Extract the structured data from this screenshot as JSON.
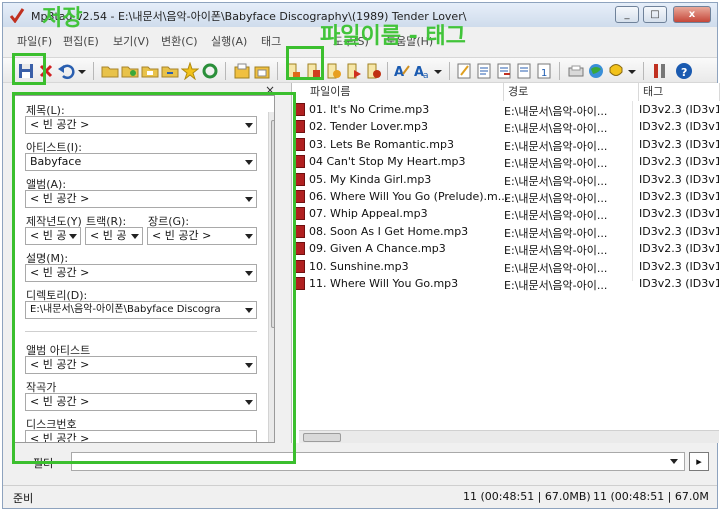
{
  "window": {
    "title": "Mp3tag v2.54 - E:\\내문서\\음악-아이폰\\Babyface Discography\\(1989) Tender Lover\\",
    "minimize": "_",
    "maximize": "□",
    "close": "x"
  },
  "menu": [
    "파일(F)",
    "편집(E)",
    "보기(V)",
    "변환(C)",
    "실행(A)",
    "태그",
    "도구(S)",
    "도움말(H)"
  ],
  "annotations": {
    "save": "저장",
    "filename_tag": "파일이름 - 태그"
  },
  "tag_panel": {
    "close_glyph": "×",
    "title_label": "제목(L):",
    "title_value": "< 빈 공간 >",
    "artist_label": "아티스트(I):",
    "artist_value": "Babyface",
    "album_label": "앨범(A):",
    "album_value": "< 빈 공간 >",
    "year_label": "제작년도(Y)",
    "year_value": "< 빈 공",
    "track_label": "트랙(R):",
    "track_value": "< 빈 공",
    "genre_label": "장르(G):",
    "genre_value": "< 빈 공간 >",
    "comment_label": "설명(M):",
    "comment_value": "< 빈 공간 >",
    "directory_label": "디렉토리(D):",
    "directory_value": "E:\\내문서\\음악-아이폰\\Babyface Discogra",
    "album_artist_label": "앨범 아티스트",
    "album_artist_value": "< 빈 공간 >",
    "composer_label": "작곡가",
    "composer_value": "< 빈 공간 >",
    "disc_label": "디스크번호",
    "disc_value": "< 빈 공간 >"
  },
  "file_list": {
    "columns": [
      "파일이름",
      "경로",
      "태그"
    ],
    "rows": [
      {
        "filename": "01. It's No Crime.mp3",
        "path": "E:\\내문서\\음악-아이...",
        "tag": "ID3v2.3 (ID3v1"
      },
      {
        "filename": "02. Tender Lover.mp3",
        "path": "E:\\내문서\\음악-아이...",
        "tag": "ID3v2.3 (ID3v1"
      },
      {
        "filename": "03. Lets Be Romantic.mp3",
        "path": "E:\\내문서\\음악-아이...",
        "tag": "ID3v2.3 (ID3v1"
      },
      {
        "filename": "04 Can't Stop My Heart.mp3",
        "path": "E:\\내문서\\음악-아이...",
        "tag": "ID3v2.3 (ID3v1"
      },
      {
        "filename": "05. My Kinda Girl.mp3",
        "path": "E:\\내문서\\음악-아이...",
        "tag": "ID3v2.3 (ID3v1"
      },
      {
        "filename": "06. Where Will You Go (Prelude).m...",
        "path": "E:\\내문서\\음악-아이...",
        "tag": "ID3v2.3 (ID3v1"
      },
      {
        "filename": "07. Whip Appeal.mp3",
        "path": "E:\\내문서\\음악-아이...",
        "tag": "ID3v2.3 (ID3v1"
      },
      {
        "filename": "08. Soon As I Get Home.mp3",
        "path": "E:\\내문서\\음악-아이...",
        "tag": "ID3v2.3 (ID3v1"
      },
      {
        "filename": "09. Given A Chance.mp3",
        "path": "E:\\내문서\\음악-아이...",
        "tag": "ID3v2.3 (ID3v1"
      },
      {
        "filename": "10. Sunshine.mp3",
        "path": "E:\\내문서\\음악-아이...",
        "tag": "ID3v2.3 (ID3v1"
      },
      {
        "filename": "11. Where Will You Go.mp3",
        "path": "E:\\내문서\\음악-아이...",
        "tag": "ID3v2.3 (ID3v1"
      }
    ]
  },
  "filter": {
    "label": "필터",
    "value": "",
    "arrow": "▸"
  },
  "status": {
    "left": "준비",
    "selected": "11 (00:48:51 | 67.0MB)",
    "total": "11 (00:48:51 | 67.0M"
  },
  "colors": {
    "annotation": "#3bbf2e",
    "file_icon": "#b02020"
  }
}
